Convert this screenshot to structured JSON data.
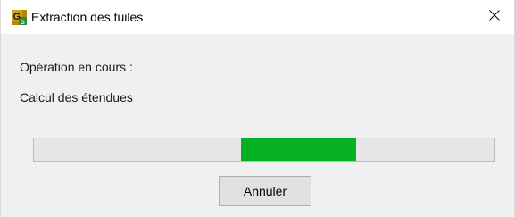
{
  "dialog": {
    "title": "Extraction des tuiles",
    "app_icon": "app-logo-icon",
    "close_icon": "close-icon",
    "status_heading": "Opération en cours :",
    "status_detail": "Calcul des étendues",
    "progress": {
      "style": "marquee",
      "segment_start": 0.45,
      "segment_end": 0.7,
      "color": "#06b025"
    },
    "cancel_label": "Annuler"
  }
}
